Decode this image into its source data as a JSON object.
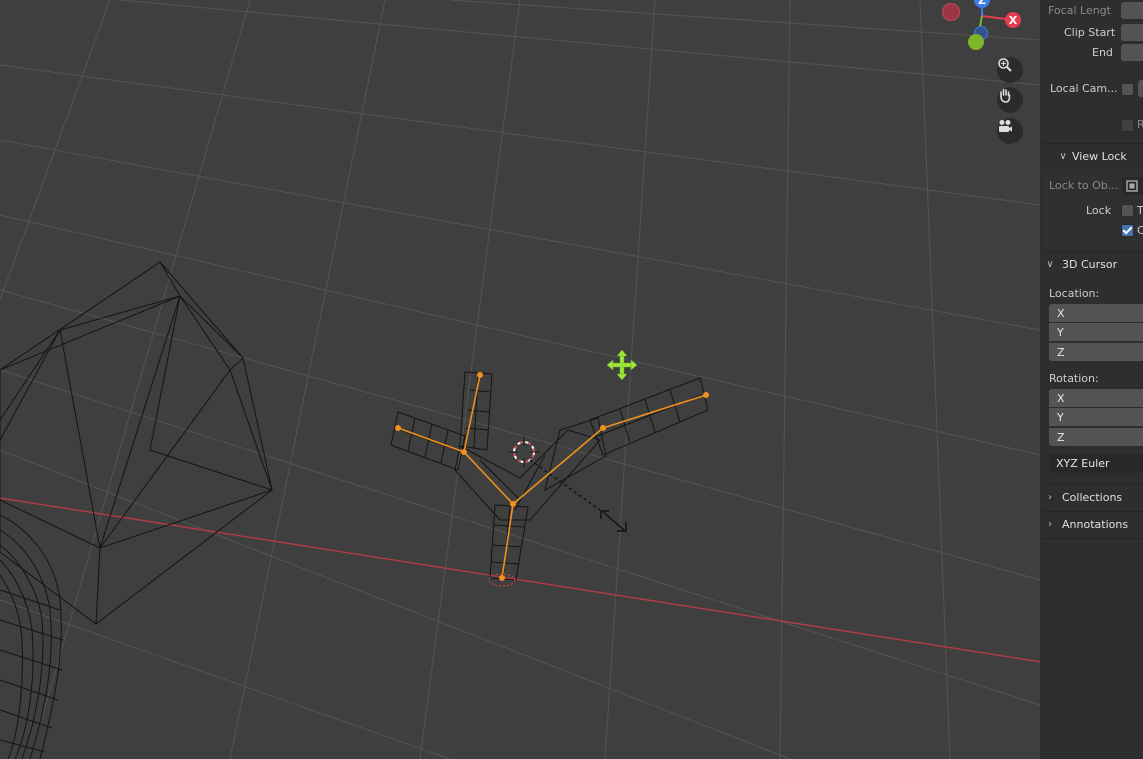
{
  "viewport": {
    "axis_labels": {
      "x": "X",
      "y": "Y",
      "z": "Z"
    },
    "colors": {
      "background": "#3f3f3f",
      "grid": "#545454",
      "x_axis_line": "#b03c44",
      "wire": "#141414",
      "bone": "#f0901e",
      "gizmo_x": "#e43d4f",
      "gizmo_y": "#7fb52a",
      "gizmo_z": "#3c7ce8",
      "move_icon": "#9ee83a"
    },
    "nav_icons": [
      "zoom-icon",
      "pan-hand-icon",
      "camera-icon"
    ]
  },
  "sidebar": {
    "view": {
      "focal_length_label": "Focal Lengt",
      "clip_start_label": "Clip Start",
      "clip_end_label": "End",
      "local_camera_label": "Local Cam...",
      "render_region_label": "R"
    },
    "view_lock": {
      "header": "View Lock",
      "lock_to_object_label": "Lock to Ob...",
      "lock_label": "Lock",
      "lock_to_3d_cursor_label": "T",
      "lock_camera_to_view_label": "C",
      "lock_camera_checked": true
    },
    "cursor_3d": {
      "header": "3D Cursor",
      "location_label": "Location:",
      "location_axes": [
        "X",
        "Y",
        "Z"
      ],
      "rotation_label": "Rotation:",
      "rotation_axes": [
        "X",
        "Y",
        "Z"
      ],
      "rotation_mode": "XYZ Euler"
    },
    "collections_header": "Collections",
    "annotations_header": "Annotations"
  }
}
